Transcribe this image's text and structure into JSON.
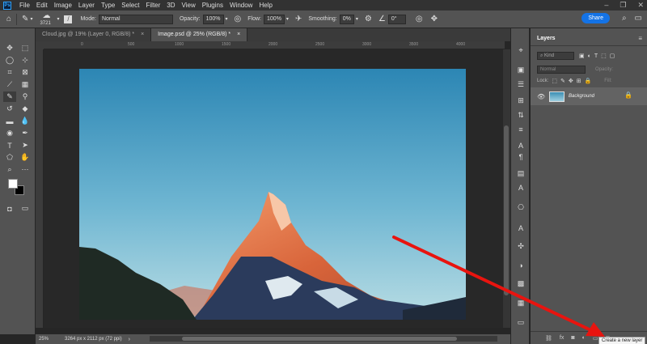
{
  "app": {
    "logo": "Ps"
  },
  "menu": [
    "File",
    "Edit",
    "Image",
    "Layer",
    "Type",
    "Select",
    "Filter",
    "3D",
    "View",
    "Plugins",
    "Window",
    "Help"
  ],
  "options": {
    "brush_size": "3721",
    "mode_label": "Mode:",
    "mode_value": "Normal",
    "opacity_label": "Opacity:",
    "opacity_value": "100%",
    "flow_label": "Flow:",
    "flow_value": "100%",
    "smoothing_label": "Smoothing:",
    "smoothing_value": "0%",
    "angle_value": "0°",
    "share_label": "Share"
  },
  "tabs": [
    {
      "label": "Cloud.jpg @ 19% (Layer 0, RGB/8) *",
      "close": "×"
    },
    {
      "label": "Image.psd @ 25% (RGB/8) *",
      "close": "×"
    }
  ],
  "ruler_ticks": [
    "0",
    "500",
    "1000",
    "1500",
    "2000",
    "2500",
    "3000",
    "3500",
    "4000"
  ],
  "status": {
    "zoom": "25%",
    "dimensions": "3264 px x 2112 px (72 ppi)"
  },
  "layers_panel": {
    "title": "Layers",
    "kind_placeholder": "Kind",
    "blend_mode": "Normal",
    "opacity_label": "Opacity:",
    "lock_label": "Lock:",
    "fill_label": "Fill:",
    "layer_name": "Background",
    "tooltip": "Create a new layer"
  },
  "colors": {
    "accent": "#1473e6",
    "arrow": "#e8140f",
    "sky_top": "#2c86b4",
    "sky_bottom": "#b9dde4"
  },
  "icons": {
    "tools": [
      "move-icon",
      "marquee-icon",
      "lasso-icon",
      "object-select-icon",
      "crop-icon",
      "frame-icon",
      "eyedropper-icon",
      "healing-icon",
      "brush-icon",
      "stamp-icon",
      "history-brush-icon",
      "eraser-icon",
      "gradient-icon",
      "blur-icon",
      "dodge-icon",
      "pen-icon",
      "type-icon",
      "path-select-icon",
      "shape-icon",
      "hand-icon",
      "zoom-icon",
      "more-icon"
    ]
  }
}
